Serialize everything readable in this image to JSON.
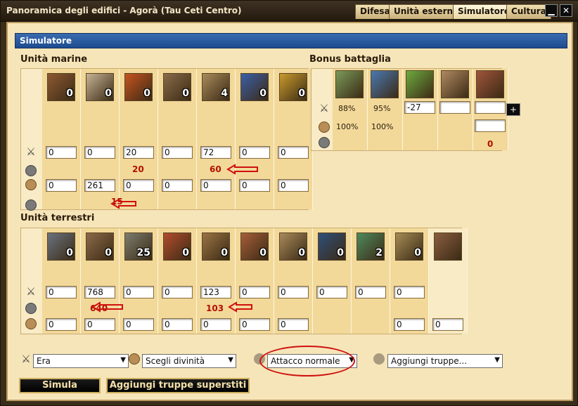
{
  "window": {
    "title": "Panoramica degli edifici - Agorà (Tau Ceti Centro)"
  },
  "tabs": [
    {
      "label": "Difesa"
    },
    {
      "label": "Unità esterne"
    },
    {
      "label": "Simulatore"
    },
    {
      "label": "Cultura"
    }
  ],
  "header": "Simulatore",
  "naval": {
    "title": "Unità marine",
    "units": [
      {
        "name": "bireme",
        "count": "0",
        "color": "#8d5a33",
        "att": "0",
        "def": "0"
      },
      {
        "name": "light-ship",
        "count": "0",
        "color": "#c7b496",
        "att": "0",
        "def": "261"
      },
      {
        "name": "fire-ship",
        "count": "0",
        "color": "#c6541f",
        "att": "20",
        "def": "0"
      },
      {
        "name": "transport-boat",
        "count": "0",
        "color": "#8a6b49",
        "att": "0",
        "def": "0"
      },
      {
        "name": "trireme",
        "count": "4",
        "color": "#a98a5c",
        "att": "72",
        "def": "0"
      },
      {
        "name": "colony-ship",
        "count": "0",
        "color": "#3b5fa8",
        "att": "0",
        "def": "0"
      },
      {
        "name": "fast-transport",
        "count": "0",
        "color": "#c99b2d",
        "att": "0",
        "def": "0"
      }
    ],
    "att_losses": [
      {
        "col": 2,
        "value": "20"
      },
      {
        "col": 4,
        "value": "60"
      }
    ],
    "def_losses": [
      {
        "col": 2,
        "value": "15"
      }
    ]
  },
  "bonus": {
    "title": "Bonus battaglia",
    "items": [
      {
        "name": "luck",
        "color": "#7a9a5a",
        "att": "88%",
        "def": "100%"
      },
      {
        "name": "morale",
        "color": "#4a79b4",
        "att": "95%",
        "def": "100%"
      },
      {
        "name": "luck-clover",
        "color": "#6eab40",
        "value": "-27"
      },
      {
        "name": "hero",
        "color": "#b08a62",
        "value": ""
      },
      {
        "name": "wall",
        "color": "#a0553c",
        "value": "",
        "extra": "0"
      }
    ]
  },
  "land": {
    "title": "Unità terrestri",
    "units": [
      {
        "name": "militia",
        "count": "0",
        "color": "#6a7380",
        "att": "0",
        "def": "0"
      },
      {
        "name": "swordsman",
        "count": "0",
        "color": "#8c6a48",
        "att": "768",
        "def": "0"
      },
      {
        "name": "archer",
        "count": "25",
        "color": "#7d7d70",
        "att": "0",
        "def": "0"
      },
      {
        "name": "hoplite",
        "count": "0",
        "color": "#b24d2e",
        "att": "0",
        "def": "0"
      },
      {
        "name": "horseman",
        "count": "0",
        "color": "#9a7445",
        "att": "123",
        "def": "0"
      },
      {
        "name": "chariot",
        "count": "0",
        "color": "#a65e3a",
        "att": "0",
        "def": "0"
      },
      {
        "name": "catapult",
        "count": "0",
        "color": "#a98a5c",
        "att": "0",
        "def": "0"
      },
      {
        "name": "harpy",
        "count": "0",
        "color": "#2f4f7a",
        "att": "0",
        "def": ""
      },
      {
        "name": "medusa",
        "count": "2",
        "color": "#4f8a5e",
        "att": "0",
        "def": ""
      },
      {
        "name": "spartan",
        "count": "0",
        "color": "#a58b55",
        "att": "0",
        "def": "0"
      },
      {
        "name": "unit-11",
        "count": "",
        "color": "#8a5e40",
        "att": "",
        "def": "0"
      }
    ],
    "att_losses": [
      {
        "col": 1,
        "value": "640"
      },
      {
        "col": 4,
        "value": "103"
      }
    ]
  },
  "controls": {
    "era": "Era",
    "god": "Scegli divinità",
    "attack_type": "Attacco normale",
    "add_troops": "Aggiungi truppe..."
  },
  "buttons": {
    "simulate": "Simula",
    "add_survivors": "Aggiungi truppe superstiti"
  },
  "add_button": "+"
}
